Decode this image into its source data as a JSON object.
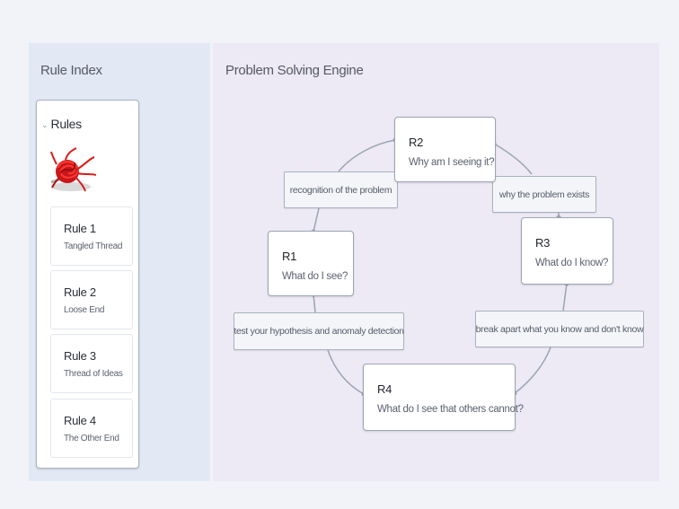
{
  "sidebar": {
    "title": "Rule Index",
    "section_label": "Rules",
    "section_icon": "chevron-down-icon",
    "image_alt": "tangled red thread",
    "rules": [
      {
        "title": "Rule 1",
        "subtitle": "Tangled Thread"
      },
      {
        "title": "Rule 2",
        "subtitle": "Loose End"
      },
      {
        "title": "Rule 3",
        "subtitle": "Thread of Ideas"
      },
      {
        "title": "Rule 4",
        "subtitle": "The Other End"
      }
    ]
  },
  "main": {
    "title": "Problem Solving Engine",
    "nodes": [
      {
        "id": "R1",
        "question": "What do I see?"
      },
      {
        "id": "R2",
        "question": "Why am I seeing it?"
      },
      {
        "id": "R3",
        "question": "What do I know?"
      },
      {
        "id": "R4",
        "question": "What do I see that others cannot?"
      }
    ],
    "edges": [
      {
        "from": "R1",
        "to": "R2",
        "label": "recognition of the problem"
      },
      {
        "from": "R2",
        "to": "R3",
        "label": "why the problem exists"
      },
      {
        "from": "R3",
        "to": "R4",
        "label": "break apart what you know and don't know"
      },
      {
        "from": "R4",
        "to": "R1",
        "label": "test your hypothesis and anomaly detection"
      }
    ]
  },
  "colors": {
    "background": "#f2f3f8",
    "sidebar_bg": "#e2e9f4",
    "canvas_bg": "#ede9f5",
    "edge": "#9aa5b4",
    "thread_red": "#d81e1e"
  }
}
